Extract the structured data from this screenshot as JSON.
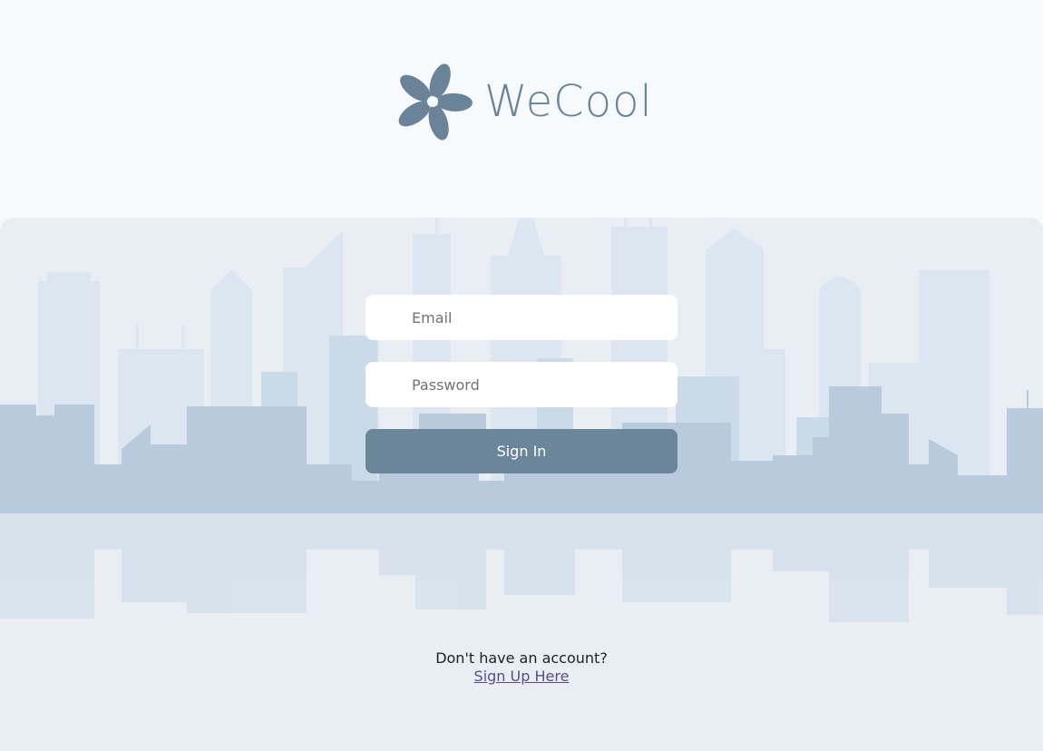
{
  "brand": {
    "name": "WeCool",
    "color": "#6a8399",
    "logo_icon": "pinwheel-flower-icon"
  },
  "form": {
    "email_placeholder": "Email",
    "password_placeholder": "Password",
    "signin_label": "Sign In",
    "button_color": "#6b8599"
  },
  "signup": {
    "prompt": "Don't have an account?",
    "link_label": "Sign Up Here"
  },
  "colors": {
    "page_background": "#f7fafd",
    "panel_background": "#e9eef4",
    "skyline": "#b8cadb"
  }
}
